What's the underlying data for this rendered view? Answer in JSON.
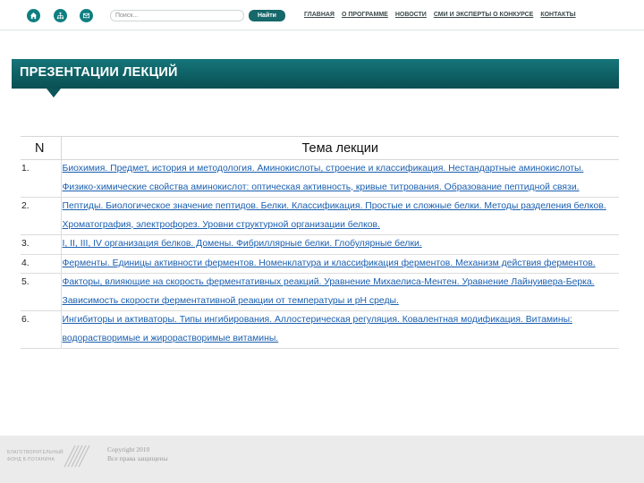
{
  "header": {
    "icons": [
      "home-icon",
      "sitemap-icon",
      "mail-icon"
    ],
    "search_placeholder": "Поиск...",
    "search_button": "Найти",
    "nav": [
      "ГЛАВНАЯ",
      "О ПРОГРАММЕ",
      "НОВОСТИ",
      "СМИ И ЭКСПЕРТЫ О КОНКУРСЕ",
      "КОНТАКТЫ"
    ]
  },
  "page": {
    "title": "ПРЕЗЕНТАЦИИ ЛЕКЦИЙ"
  },
  "table": {
    "headers": [
      "N",
      "Тема лекции"
    ],
    "rows": [
      {
        "num": "1.",
        "topic": "Биохимия. Предмет, история и методология. Аминокислоты, строение и классификация. Нестандартные аминокислоты. Физико-химические свойства аминокислот: оптическая активность, кривые титрования. Образование пептидной связи."
      },
      {
        "num": "2.",
        "topic": "Пептиды. Биологическое значение пептидов. Белки. Классификация. Простые и сложные белки. Методы разделения белков. Хроматография, электрофорез. Уровни структурной организации белков."
      },
      {
        "num": "3.",
        "topic": "I, II, III, IV организация белков. Домены. Фибриллярные белки. Глобулярные белки."
      },
      {
        "num": "4.",
        "topic": "Ферменты. Единицы активности ферментов. Номенклатура и классификация ферментов. Механизм действия ферментов."
      },
      {
        "num": "5.",
        "topic": "Факторы, влияющие на скорость ферментативных реакций. Уравнение Михаелиса-Ментен. Уравнение Лайнуивера-Берка. Зависимость скорости ферментативной реакции от температуры и pH среды."
      },
      {
        "num": "6.",
        "topic": "Ингибиторы и активаторы. Типы ингибирования. Аллостерическая регуляция. Ковалентная модификация. Витамины: водорастворимые и жирорастворимые витамины."
      }
    ]
  },
  "footer": {
    "logo_line1": "БЛАГОТВОРИТЕЛЬНЫЙ",
    "logo_line2": "ФОНД В.ПОТАНИНА",
    "copyright_line1": "Copyright 2010",
    "copyright_line2": "Все права защищены"
  },
  "colors": {
    "accent": "#0f7e80",
    "banner": "#0d5e62",
    "link": "#1a5fb0"
  }
}
